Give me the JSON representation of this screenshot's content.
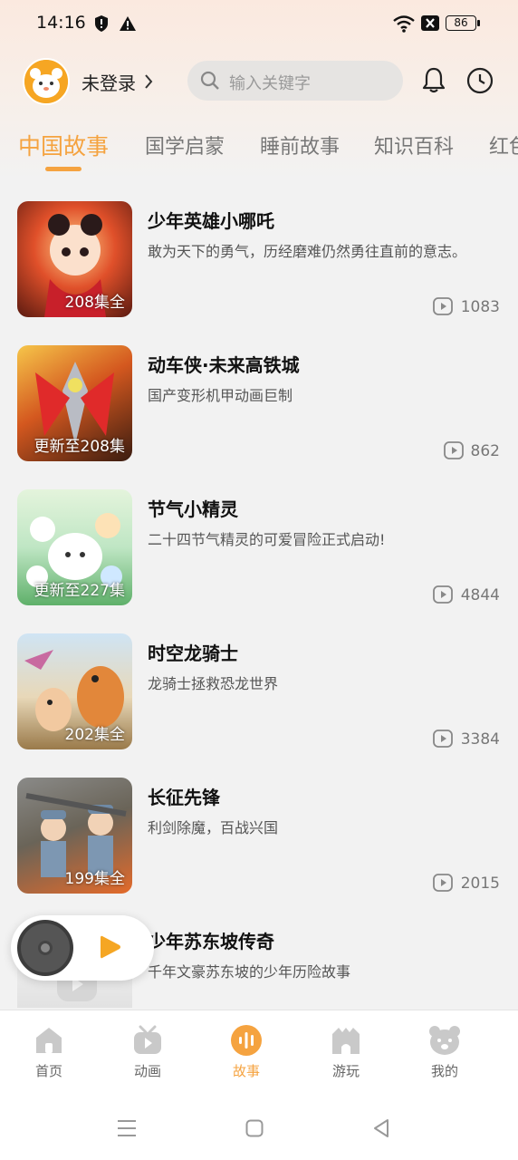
{
  "status_bar": {
    "time": "14:16",
    "battery": "86"
  },
  "header": {
    "login_label": "未登录",
    "search_placeholder": "输入关键字"
  },
  "tabs": [
    {
      "label": "中国故事",
      "active": true
    },
    {
      "label": "国学启蒙",
      "active": false
    },
    {
      "label": "睡前故事",
      "active": false
    },
    {
      "label": "知识百科",
      "active": false
    },
    {
      "label": "红色",
      "active": false
    }
  ],
  "stories": [
    {
      "title": "少年英雄小哪吒",
      "desc": "敢为天下的勇气，历经磨难仍然勇往直前的意志。",
      "badge": "208集全",
      "plays": "1083"
    },
    {
      "title": "动车侠·未来高铁城",
      "desc": "国产变形机甲动画巨制",
      "badge": "更新至208集",
      "plays": "862"
    },
    {
      "title": "节气小精灵",
      "desc": "二十四节气精灵的可爱冒险正式启动!",
      "badge": "更新至227集",
      "plays": "4844"
    },
    {
      "title": "时空龙骑士",
      "desc": "龙骑士拯救恐龙世界",
      "badge": "202集全",
      "plays": "3384"
    },
    {
      "title": "长征先锋",
      "desc": "利剑除魔，百战兴国",
      "badge": "199集全",
      "plays": "2015"
    },
    {
      "title": "少年苏东坡传奇",
      "desc": "千年文豪苏东坡的少年历险故事",
      "badge": "",
      "plays": ""
    }
  ],
  "bottom_nav": [
    {
      "label": "首页",
      "icon": "home-icon",
      "active": false
    },
    {
      "label": "动画",
      "icon": "tv-icon",
      "active": false
    },
    {
      "label": "故事",
      "icon": "audio-wave-icon",
      "active": true
    },
    {
      "label": "游玩",
      "icon": "castle-icon",
      "active": false
    },
    {
      "label": "我的",
      "icon": "bear-icon",
      "active": false
    }
  ],
  "colors": {
    "accent": "#f5a340",
    "background": "#f2f2f2"
  }
}
